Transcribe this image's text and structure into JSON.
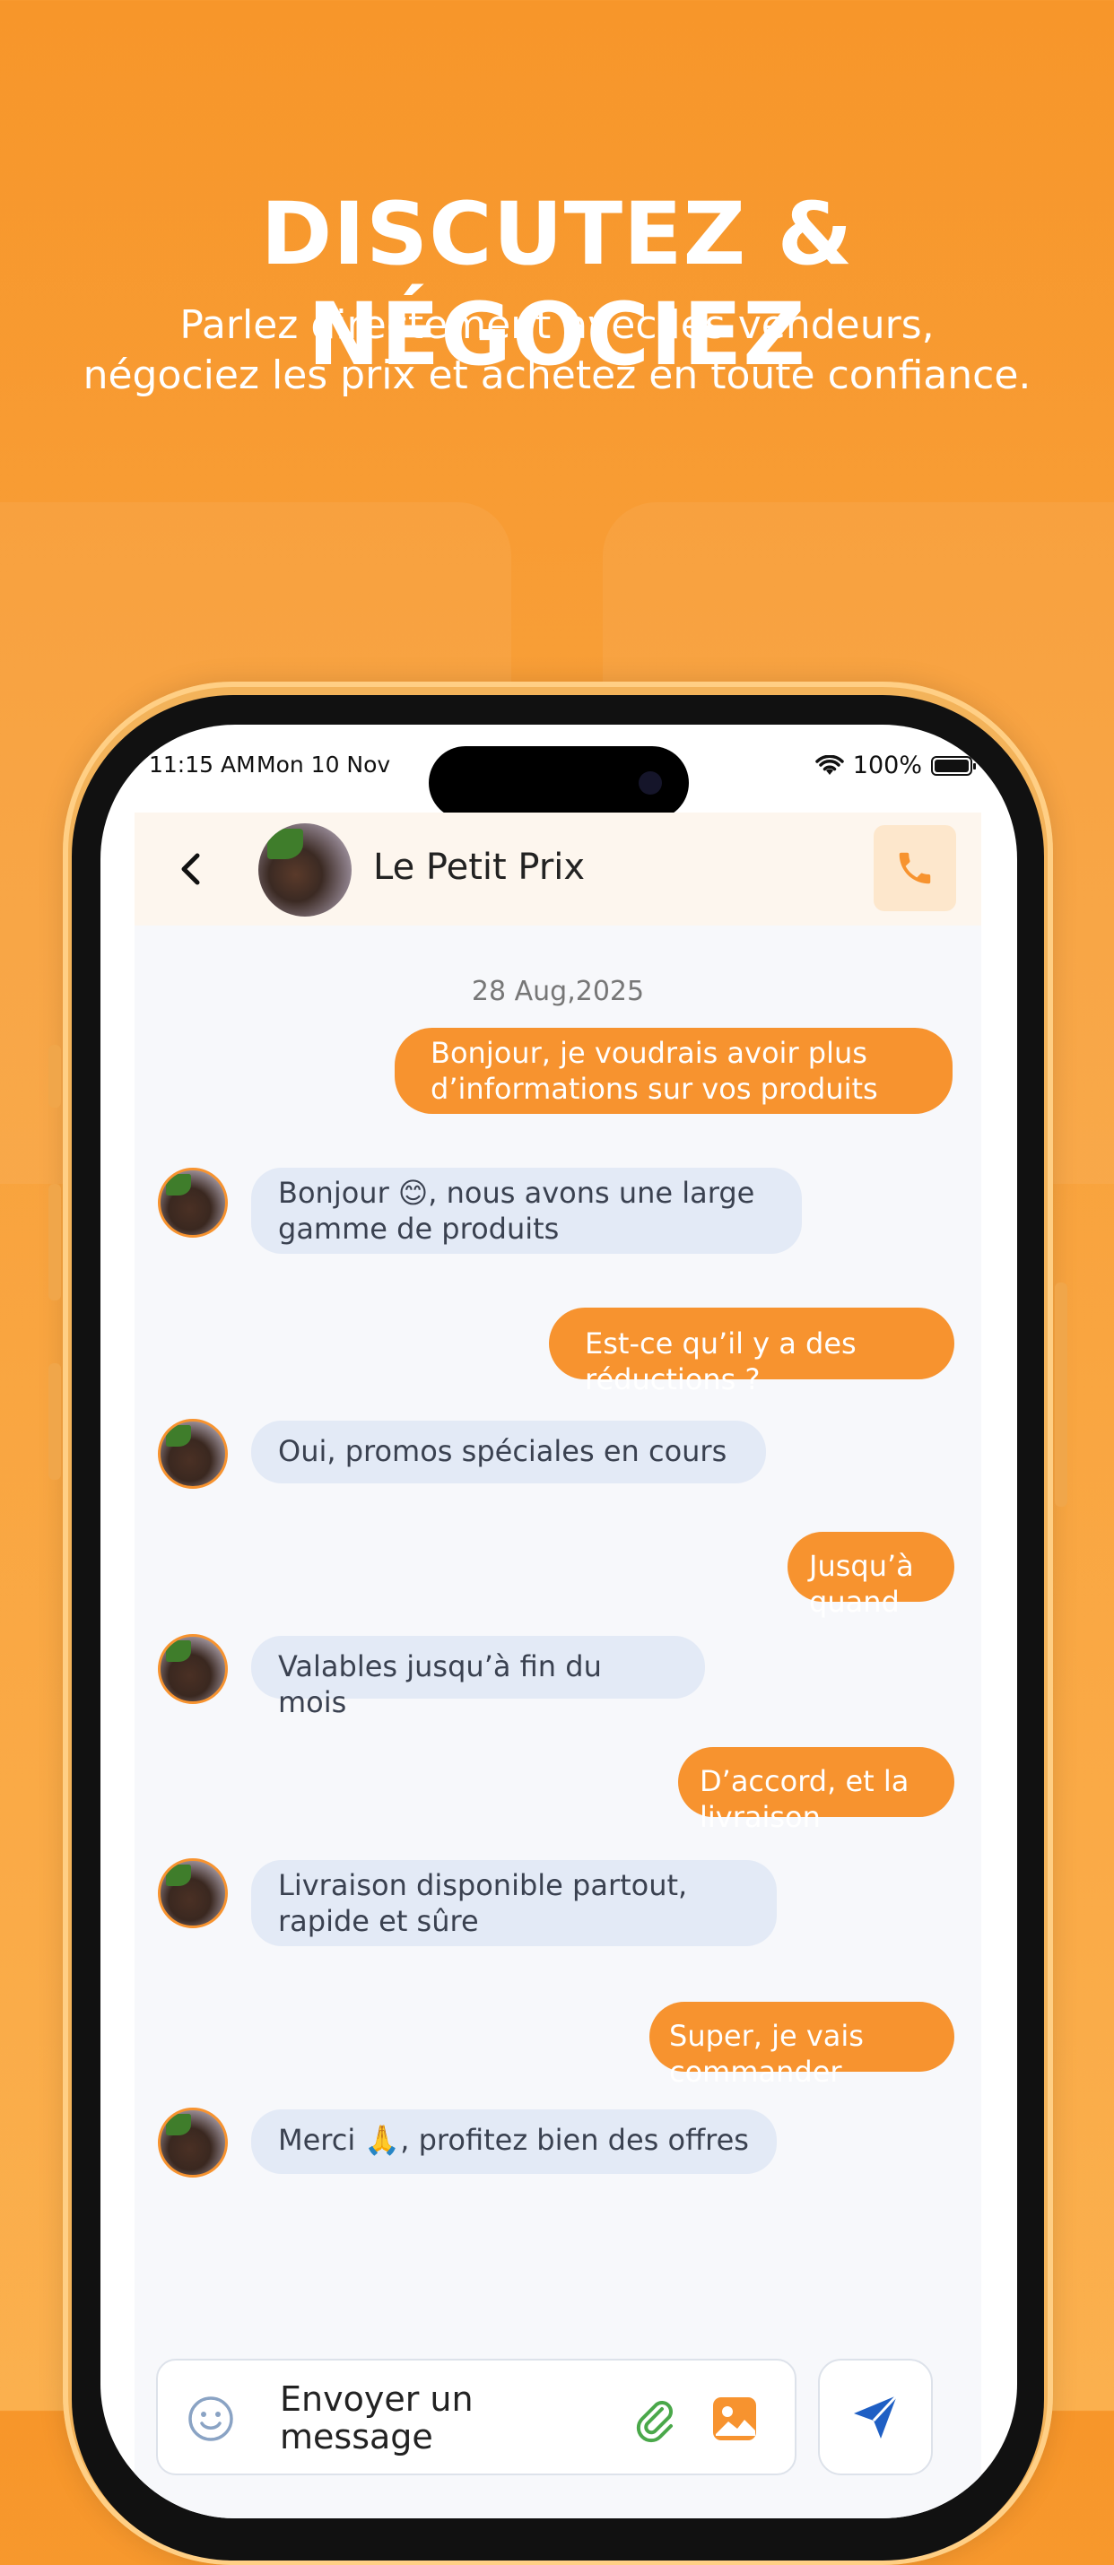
{
  "promo": {
    "headline": "DISCUTEZ & NÉGOCIEZ",
    "subline_1": "Parlez directement avec les vendeurs,",
    "subline_2": "négociez les prix et achetez en toute confiance."
  },
  "status_bar": {
    "time": "11:15 AM",
    "date": "Mon 10 Nov",
    "battery": "100%"
  },
  "chat": {
    "contact_name": "Le Petit Prix",
    "date_separator": "28 Aug,2025",
    "messages": [
      {
        "from": "me",
        "text_1": "Bonjour, je voudrais avoir plus",
        "text_2": "d’informations sur vos produits"
      },
      {
        "from": "seller",
        "text_1": "Bonjour 😊, nous avons une large",
        "text_2": "gamme de produits"
      },
      {
        "from": "me",
        "text_1": "Est-ce qu’il y a des réductions ?"
      },
      {
        "from": "seller",
        "text_1": "Oui, promos spéciales en cours"
      },
      {
        "from": "me",
        "text_1": "Jusqu’à quand"
      },
      {
        "from": "seller",
        "text_1": "Valables jusqu’à fin du mois"
      },
      {
        "from": "me",
        "text_1": "D’accord, et la livraison"
      },
      {
        "from": "seller",
        "text_1": "Livraison disponible partout,",
        "text_2": "rapide et sûre"
      },
      {
        "from": "me",
        "text_1": "Super, je vais commander"
      },
      {
        "from": "seller",
        "text_1": "Merci 🙏, profitez bien des offres"
      }
    ],
    "composer_placeholder": "Envoyer un message"
  },
  "colors": {
    "accent": "#f7932f",
    "incoming_bubble": "#e3eaf6",
    "send_icon": "#1f5fc4"
  },
  "icons": [
    "back-icon",
    "phone-icon",
    "emoji-icon",
    "paperclip-icon",
    "image-icon",
    "send-icon",
    "wifi-icon",
    "battery-icon"
  ]
}
